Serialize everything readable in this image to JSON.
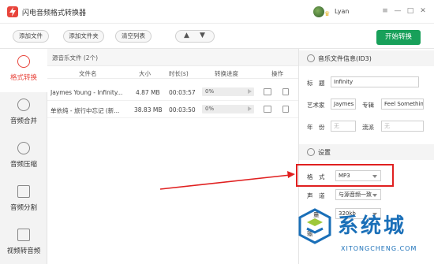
{
  "app": {
    "title": "闪电音频格式转换器",
    "user_name": "Lyan"
  },
  "window_controls": [
    "≡",
    "—",
    "□",
    "✕"
  ],
  "toolbar": {
    "add_file": "添加文件",
    "add_folder": "添加文件夹",
    "clear_list": "清空列表",
    "move_up": "▲",
    "move_down": "▼",
    "start": "开始转换"
  },
  "sidebar": {
    "items": [
      {
        "label": "格式转换",
        "icon": "refresh-icon",
        "active": true
      },
      {
        "label": "音频合并",
        "icon": "merge-icon",
        "active": false
      },
      {
        "label": "音频压缩",
        "icon": "compress-icon",
        "active": false
      },
      {
        "label": "音频分割",
        "icon": "split-icon",
        "active": false
      },
      {
        "label": "视频转音频",
        "icon": "video-play-icon",
        "active": false
      }
    ]
  },
  "file_panel": {
    "header": "源音乐文件 (2个)",
    "columns": [
      "文件名",
      "大小",
      "时长(s)",
      "转换进度",
      "操作"
    ],
    "rows": [
      {
        "name": "Jaymes Young - Infinity...",
        "size": "4.87 MB",
        "duration": "00:03:57",
        "progress": "0%"
      },
      {
        "name": "单依纯 - 旅行中忘记 (新...",
        "size": "38.83 MB",
        "duration": "00:03:50",
        "progress": "0%"
      }
    ]
  },
  "info_panel": {
    "id3_title": "音乐文件信息(ID3)",
    "title_label": "标　题",
    "title_value": "Infinity",
    "artist_label": "艺术家",
    "artist_value": "Jaymes",
    "album_label": "专辑",
    "album_value": "Feel Something",
    "year_label": "年　份",
    "year_placeholder": "无",
    "genre_label": "流派",
    "genre_placeholder": "无",
    "settings_title": "设置",
    "format_label": "格　式",
    "format_value": "MP3",
    "channel_label": "声　道",
    "channel_value": "与源音频一致",
    "quality_label": "量",
    "quality_value": "320kb",
    "output_label": "输"
  },
  "watermark": {
    "cn": "系统城",
    "en": "XITONGCHENG.COM"
  },
  "colors": {
    "accent": "#e8453c",
    "start_button": "#18a05a",
    "highlight": "#e02020",
    "watermark": "#1a6fb8"
  }
}
